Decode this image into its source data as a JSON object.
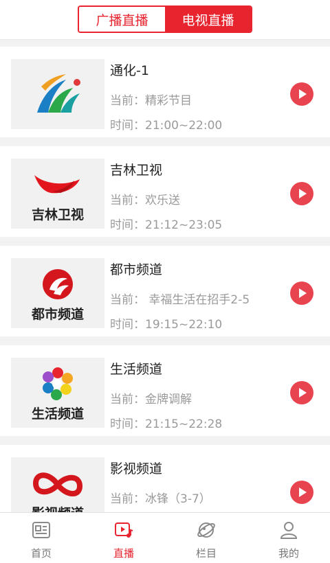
{
  "header": {
    "tabs": [
      {
        "label": "广播直播",
        "active": false
      },
      {
        "label": "电视直播",
        "active": true
      }
    ]
  },
  "channels": [
    {
      "name": "通化-1",
      "current": "当前：精彩节目",
      "time": "时间：21:00~22:00",
      "logo_text": ""
    },
    {
      "name": "吉林卫视",
      "current": "当前：欢乐送",
      "time": "时间：21:12~23:05",
      "logo_text": "吉林卫视"
    },
    {
      "name": "都市频道",
      "current": "当前：  幸福生活在招手2-5",
      "time": "时间：19:15~22:10",
      "logo_text": "都市频道"
    },
    {
      "name": "生活频道",
      "current": "当前：金牌调解",
      "time": "时间：21:15~22:28",
      "logo_text": "生活频道"
    },
    {
      "name": "影视频道",
      "current": "当前：冰锋（3-7）",
      "time": "",
      "logo_text": "影视频道"
    }
  ],
  "tabbar": {
    "items": [
      {
        "label": "首页",
        "icon": "news-icon",
        "active": false
      },
      {
        "label": "直播",
        "icon": "live-video-icon",
        "active": true
      },
      {
        "label": "栏目",
        "icon": "planet-icon",
        "active": false
      },
      {
        "label": "我的",
        "icon": "user-icon",
        "active": false
      }
    ]
  },
  "colors": {
    "accent": "#e8242f",
    "play_button": "#e8444f",
    "secondary_text": "#9a9a9a"
  }
}
